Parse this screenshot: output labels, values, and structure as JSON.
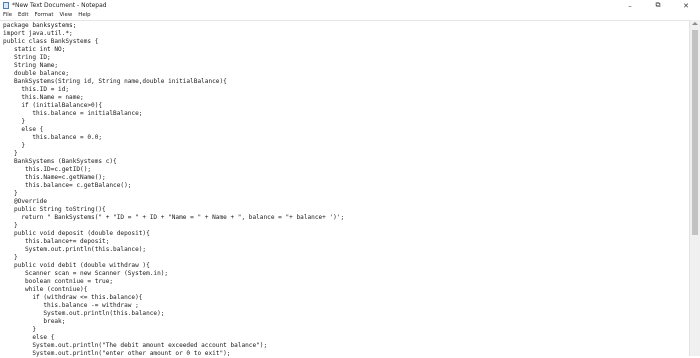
{
  "window": {
    "title": "*New Text Document - Notepad",
    "minimize": "–",
    "maximize": "⧉",
    "close": "✕"
  },
  "menu": {
    "file": "File",
    "edit": "Edit",
    "format": "Format",
    "view": "View",
    "help": "Help"
  },
  "editor": {
    "lines": [
      "package banksystems;",
      "import java.util.*;",
      "public class BankSystems {",
      "   static int NO;",
      "   String ID;",
      "   String Name;",
      "   double balance;",
      "   BankSystems(String id, String name,double initialBalance){",
      "     this.ID = id;",
      "     this.Name = name;",
      "     if (initialBalance>0){",
      "        this.balance = initialBalance;",
      "     }",
      "     else {",
      "        this.balance = 0.0;",
      "     }",
      "   }",
      "   BankSystems (BankSystems c){",
      "      this.ID=c.getID();",
      "      this.Name=c.getName();",
      "      this.balance= c.getBalance();",
      "   }",
      "   @Override",
      "   public String toString(){",
      "     return \" BankSystems(\" + \"ID = \" + ID + \"Name = \" + Name + \", balance = \"+ balance+ ')';",
      "   }",
      "   public void deposit (double deposit){",
      "      this.balance+= deposit;",
      "      System.out.println(this.balance);",
      "   }",
      "   public void debit (double withdraw ){",
      "      Scanner scan = new Scanner (System.in);",
      "      boolean contniue = true;",
      "      while (contniue){",
      "        if (withdraw <= this.balance){",
      "           this.balance -= withdraw ;",
      "           System.out.println(this.balance);",
      "           break;",
      "        }",
      "        else {",
      "        System.out.println(\"The debit amount exceeded account balance\");",
      "        System.out.println(\"enter other amount or 0 to exit\");"
    ]
  }
}
